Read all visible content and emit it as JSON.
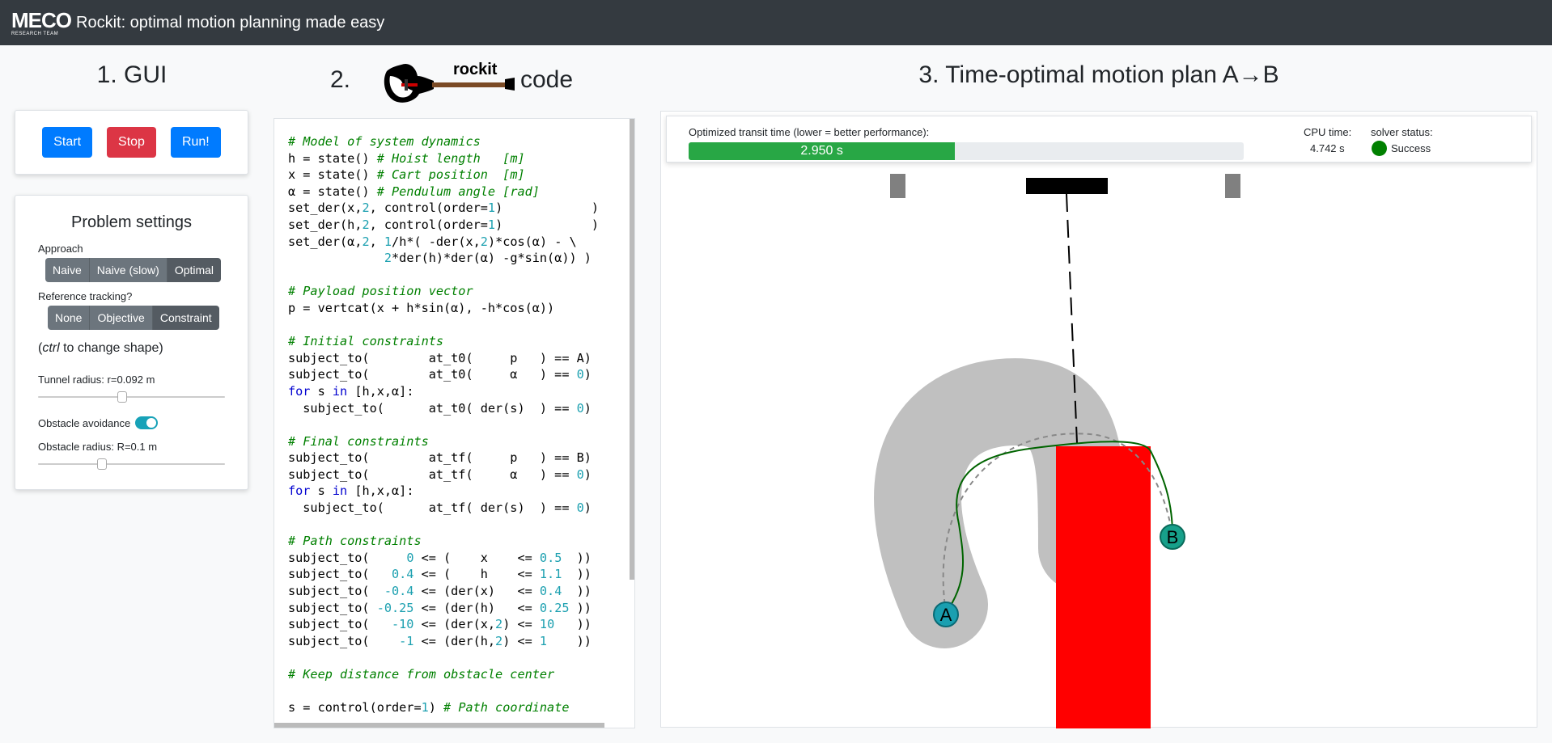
{
  "navbar": {
    "logo_text": "MECO",
    "logo_subtext": "RESEARCH TEAM",
    "title": "Rockit: optimal motion planning made easy"
  },
  "section1": {
    "title": "1. GUI"
  },
  "section2": {
    "number": "2.",
    "logo_text": "rockit",
    "suffix": "code"
  },
  "section3": {
    "title": "3. Time-optimal motion plan A→B"
  },
  "gui": {
    "start_label": "Start",
    "stop_label": "Stop",
    "run_label": "Run!",
    "colors": {
      "primary": "#007bff",
      "danger": "#dc3545"
    }
  },
  "settings": {
    "title": "Problem settings",
    "approach_label": "Approach",
    "approach_options": [
      "Naive",
      "Naive (slow)",
      "Optimal"
    ],
    "approach_selected": "Optimal",
    "tracking_label": "Reference tracking?",
    "tracking_options": [
      "None",
      "Objective",
      "Constraint"
    ],
    "tracking_selected": "Constraint",
    "hint_prefix": "(",
    "hint_key": "ctrl",
    "hint_suffix": " to change shape)",
    "tunnel_label": "Tunnel radius:",
    "tunnel_value": "r=0.092 m",
    "tunnel_slider_fraction": 0.45,
    "obstacle_avoid_label": "Obstacle avoidance",
    "obstacle_avoid_on": true,
    "obstacle_radius_label": "Obstacle radius:",
    "obstacle_radius_value": "R=0.1 m",
    "obstacle_slider_fraction": 0.34
  },
  "code_lines": [
    [
      [
        "c",
        "# Model of system dynamics"
      ]
    ],
    [
      [
        "t",
        "h = state() "
      ],
      [
        "c",
        "# Hoist length   [m]"
      ]
    ],
    [
      [
        "t",
        "x = state() "
      ],
      [
        "c",
        "# Cart position  [m]"
      ]
    ],
    [
      [
        "t",
        "α = state() "
      ],
      [
        "c",
        "# Pendulum angle [rad]"
      ]
    ],
    [
      [
        "t",
        "set_der(x,"
      ],
      [
        "n",
        "2"
      ],
      [
        "t",
        ", control(order="
      ],
      [
        "n",
        "1"
      ],
      [
        "t",
        ")            )"
      ]
    ],
    [
      [
        "t",
        "set_der(h,"
      ],
      [
        "n",
        "2"
      ],
      [
        "t",
        ", control(order="
      ],
      [
        "n",
        "1"
      ],
      [
        "t",
        ")            )"
      ]
    ],
    [
      [
        "t",
        "set_der(α,"
      ],
      [
        "n",
        "2"
      ],
      [
        "t",
        ", "
      ],
      [
        "n",
        "1"
      ],
      [
        "t",
        "/h*( -der(x,"
      ],
      [
        "n",
        "2"
      ],
      [
        "t",
        ")*cos(α) - \\"
      ]
    ],
    [
      [
        "t",
        "             "
      ],
      [
        "n",
        "2"
      ],
      [
        "t",
        "*der(h)*der(α) -g*sin(α)) )"
      ]
    ],
    [
      [
        "t",
        ""
      ]
    ],
    [
      [
        "c",
        "# Payload position vector"
      ]
    ],
    [
      [
        "t",
        "p = vertcat(x + h*sin(α), -h*cos(α))"
      ]
    ],
    [
      [
        "t",
        ""
      ]
    ],
    [
      [
        "c",
        "# Initial constraints"
      ]
    ],
    [
      [
        "t",
        "subject_to(        at_t0(     p   ) == A)"
      ]
    ],
    [
      [
        "t",
        "subject_to(        at_t0(     α   ) == "
      ],
      [
        "n",
        "0"
      ],
      [
        "t",
        ")"
      ]
    ],
    [
      [
        "k",
        "for"
      ],
      [
        "t",
        " s "
      ],
      [
        "k",
        "in"
      ],
      [
        "t",
        " [h,x,α]:"
      ]
    ],
    [
      [
        "t",
        "  subject_to(      at_t0( der(s)  ) == "
      ],
      [
        "n",
        "0"
      ],
      [
        "t",
        ")"
      ]
    ],
    [
      [
        "t",
        ""
      ]
    ],
    [
      [
        "c",
        "# Final constraints"
      ]
    ],
    [
      [
        "t",
        "subject_to(        at_tf(     p   ) == B)"
      ]
    ],
    [
      [
        "t",
        "subject_to(        at_tf(     α   ) == "
      ],
      [
        "n",
        "0"
      ],
      [
        "t",
        ")"
      ]
    ],
    [
      [
        "k",
        "for"
      ],
      [
        "t",
        " s "
      ],
      [
        "k",
        "in"
      ],
      [
        "t",
        " [h,x,α]:"
      ]
    ],
    [
      [
        "t",
        "  subject_to(      at_tf( der(s)  ) == "
      ],
      [
        "n",
        "0"
      ],
      [
        "t",
        ")"
      ]
    ],
    [
      [
        "t",
        ""
      ]
    ],
    [
      [
        "c",
        "# Path constraints"
      ]
    ],
    [
      [
        "t",
        "subject_to(     "
      ],
      [
        "n",
        "0"
      ],
      [
        "t",
        " <= (    x    <= "
      ],
      [
        "n",
        "0.5"
      ],
      [
        "t",
        "  ))"
      ]
    ],
    [
      [
        "t",
        "subject_to(   "
      ],
      [
        "n",
        "0.4"
      ],
      [
        "t",
        " <= (    h    <= "
      ],
      [
        "n",
        "1.1"
      ],
      [
        "t",
        "  ))"
      ]
    ],
    [
      [
        "t",
        "subject_to(  "
      ],
      [
        "n",
        "-0.4"
      ],
      [
        "t",
        " <= (der(x)   <= "
      ],
      [
        "n",
        "0.4"
      ],
      [
        "t",
        "  ))"
      ]
    ],
    [
      [
        "t",
        "subject_to( "
      ],
      [
        "n",
        "-0.25"
      ],
      [
        "t",
        " <= (der(h)   <= "
      ],
      [
        "n",
        "0.25"
      ],
      [
        "t",
        " ))"
      ]
    ],
    [
      [
        "t",
        "subject_to(   "
      ],
      [
        "n",
        "-10"
      ],
      [
        "t",
        " <= (der(x,"
      ],
      [
        "n",
        "2"
      ],
      [
        "t",
        ") <= "
      ],
      [
        "n",
        "10"
      ],
      [
        "t",
        "   ))"
      ]
    ],
    [
      [
        "t",
        "subject_to(    "
      ],
      [
        "n",
        "-1"
      ],
      [
        "t",
        " <= (der(h,"
      ],
      [
        "n",
        "2"
      ],
      [
        "t",
        ") <= "
      ],
      [
        "n",
        "1"
      ],
      [
        "t",
        "    ))"
      ]
    ],
    [
      [
        "t",
        ""
      ]
    ],
    [
      [
        "c",
        "# Keep distance from obstacle center"
      ]
    ],
    [
      [
        "t",
        ""
      ]
    ],
    [
      [
        "t",
        "s = control(order="
      ],
      [
        "n",
        "1"
      ],
      [
        "t",
        ") "
      ],
      [
        "c",
        "# Path coordinate"
      ]
    ]
  ],
  "metrics": {
    "transit_label": "Optimized transit time (lower = better performance):",
    "transit_value": "2.950 s",
    "transit_fraction": 0.48,
    "cpu_label": "CPU time:",
    "cpu_value": "4.742 s",
    "status_label": "solver status:",
    "status_value": "Success",
    "bar_color": "#28a745",
    "status_color": "#008000"
  },
  "plot": {
    "point_a_label": "A",
    "point_b_label": "B",
    "obstacle_color": "#ff0000",
    "tunnel_color": "#c0c0c0",
    "marker_color": "#1a9fb0",
    "optimal_path_color": "#006400",
    "reference_path_color": "#888888"
  }
}
